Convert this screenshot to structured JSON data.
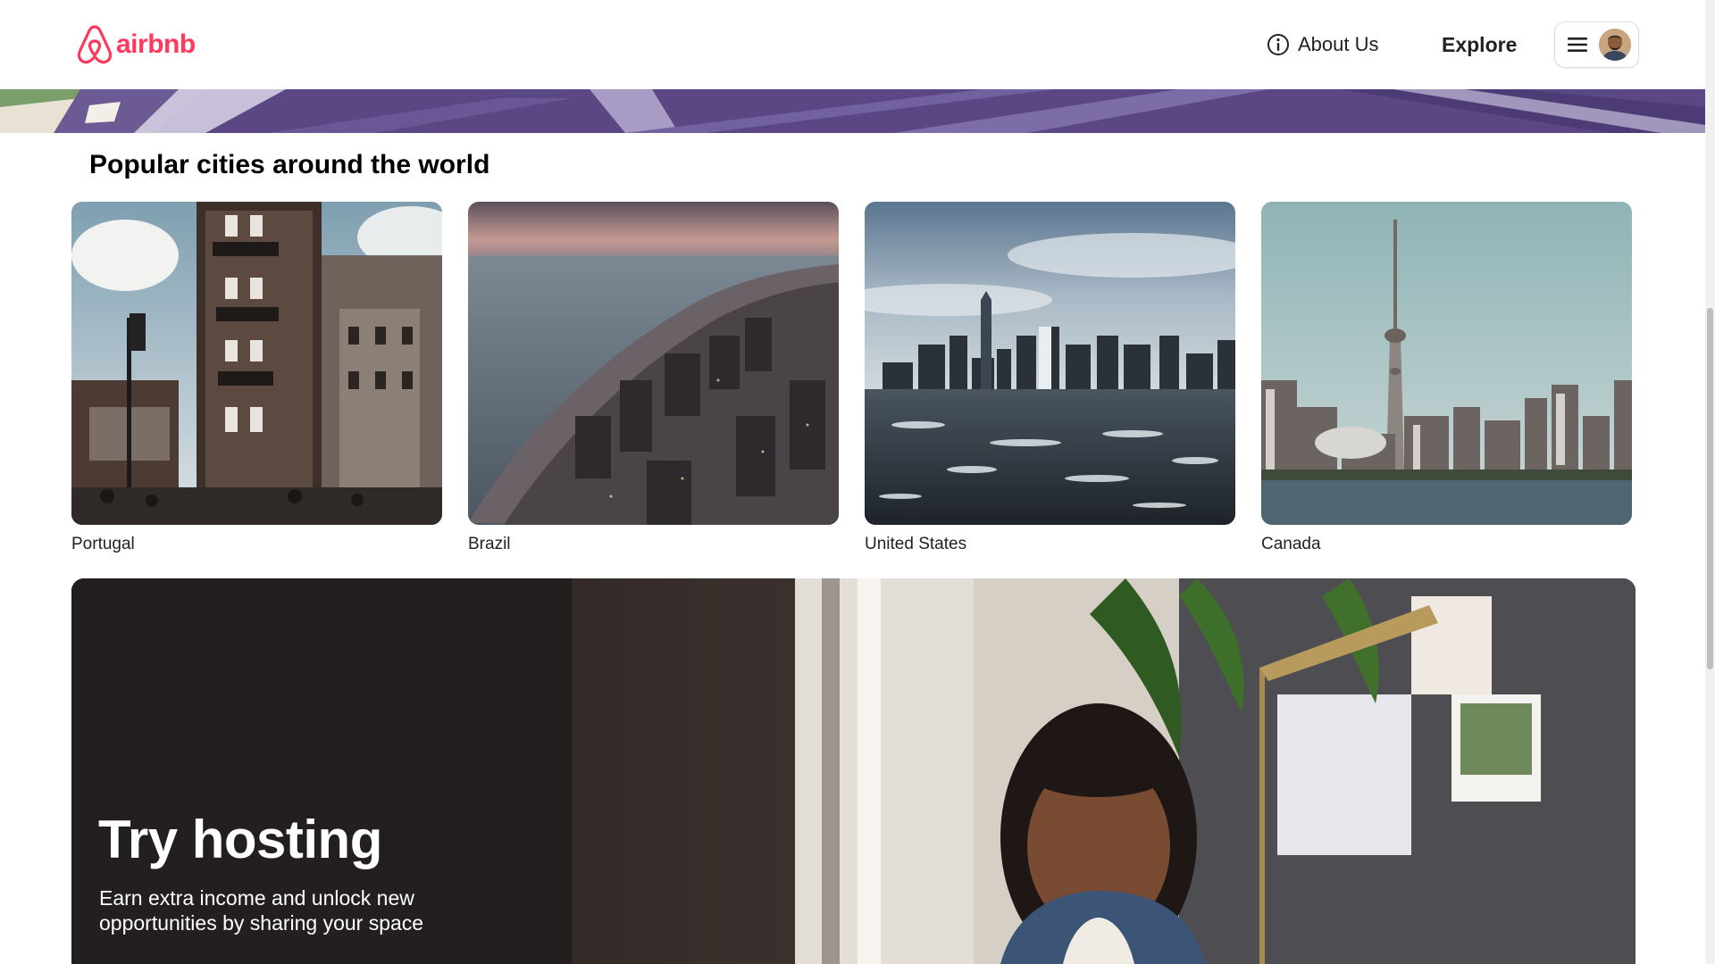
{
  "header": {
    "logo_text": "airbnb",
    "about_label": "About Us",
    "explore_label": "Explore"
  },
  "section": {
    "title": "Popular cities around the world"
  },
  "cities": [
    {
      "name": "Portugal"
    },
    {
      "name": "Brazil"
    },
    {
      "name": "United States"
    },
    {
      "name": "Canada"
    }
  ],
  "hosting": {
    "title": "Try hosting",
    "description": "Earn extra income and unlock new opportunities by sharing your space"
  },
  "colors": {
    "brand": "#ff385c",
    "banner": "#5f4a86",
    "hosting_bg": "#231f1f"
  },
  "icons": {
    "logo": "airbnb-belo-icon",
    "about": "info-circle-icon",
    "menu": "hamburger-menu-icon",
    "user": "user-avatar"
  }
}
